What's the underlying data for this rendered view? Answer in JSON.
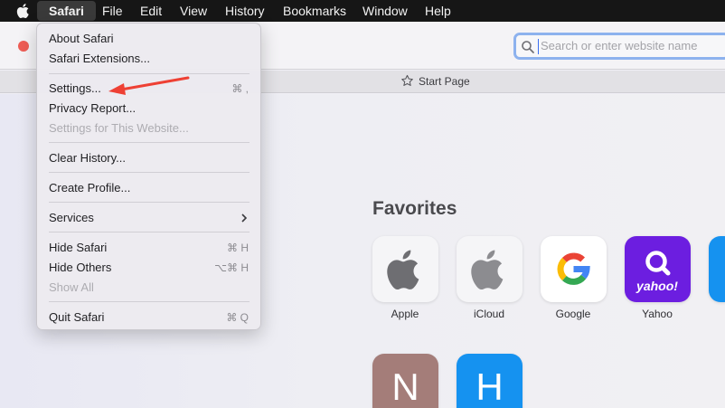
{
  "menubar": {
    "items": [
      "Safari",
      "File",
      "Edit",
      "View",
      "History",
      "Bookmarks",
      "Window",
      "Help"
    ]
  },
  "address": {
    "placeholder": "Search or enter website name"
  },
  "tab": {
    "title": "Start Page"
  },
  "menu": {
    "about": "About Safari",
    "extensions": "Safari Extensions...",
    "settings": "Settings...",
    "settings_shortcut": "⌘ ,",
    "privacy": "Privacy Report...",
    "settings_site": "Settings for This Website...",
    "clear_history": "Clear History...",
    "create_profile": "Create Profile...",
    "services": "Services",
    "hide_safari": "Hide Safari",
    "hide_safari_shortcut": "⌘ H",
    "hide_others": "Hide Others",
    "hide_others_shortcut": "⌥⌘ H",
    "show_all": "Show All",
    "quit": "Quit Safari",
    "quit_shortcut": "⌘ Q"
  },
  "favorites": {
    "title": "Favorites",
    "items": [
      {
        "label": "Apple",
        "icon": "apple-icon"
      },
      {
        "label": "iCloud",
        "icon": "apple-icon"
      },
      {
        "label": "Google",
        "icon": "google-icon"
      },
      {
        "label": "Yahoo",
        "icon": "yahoo-icon"
      }
    ],
    "row2": [
      "N",
      "H"
    ]
  },
  "colors": {
    "accent_arrow": "#ee4034",
    "yahoo": "#6c1ee0",
    "tile_n": "#a47d79",
    "tile_h": "#1592f0"
  }
}
